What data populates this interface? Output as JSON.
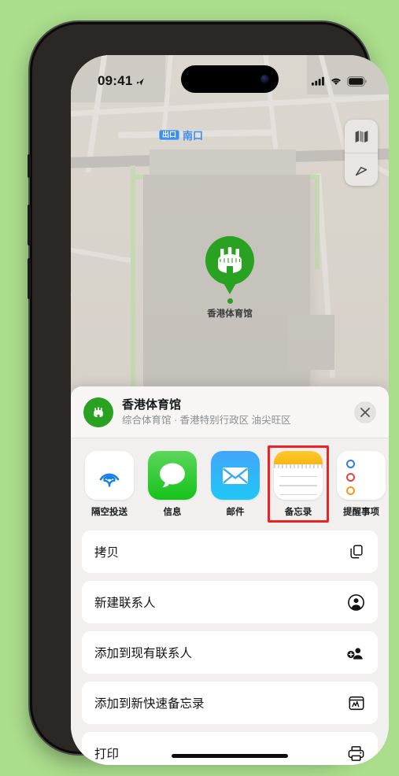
{
  "status_bar": {
    "time": "09:41",
    "location_arrow_icon": "location-arrow-icon",
    "cellular_icon": "cellular-signal-icon",
    "wifi_icon": "wifi-icon",
    "battery_icon": "battery-icon"
  },
  "map": {
    "exit_badge": "出口",
    "exit_label": "南口",
    "poi_label": "香港体育馆",
    "poi_pin_icon": "stadium-pin-icon",
    "controls": [
      {
        "name": "map-type-button",
        "icon": "folded-map-icon"
      },
      {
        "name": "locate-me-button",
        "icon": "navigation-arrow-icon"
      }
    ]
  },
  "share_sheet": {
    "avatar_icon": "stadium-icon",
    "title": "香港体育馆",
    "subtitle": "综合体育馆 · 香港特别行政区 油尖旺区",
    "close_icon": "close-icon",
    "apps": [
      {
        "label": "隔空投送",
        "icon": "airdrop-icon",
        "highlighted": false
      },
      {
        "label": "信息",
        "icon": "messages-icon",
        "highlighted": false
      },
      {
        "label": "邮件",
        "icon": "mail-icon",
        "highlighted": false
      },
      {
        "label": "备忘录",
        "icon": "notes-icon",
        "highlighted": true
      },
      {
        "label": "提醒事项",
        "icon": "reminders-icon",
        "highlighted": false
      }
    ],
    "actions": [
      {
        "label": "拷贝",
        "icon": "copy-icon"
      },
      {
        "label": "新建联系人",
        "icon": "person-circle-icon"
      },
      {
        "label": "添加到现有联系人",
        "icon": "person-add-icon"
      },
      {
        "label": "添加到新快速备忘录",
        "icon": "quick-note-icon"
      },
      {
        "label": "打印",
        "icon": "printer-icon"
      }
    ]
  },
  "colors": {
    "page_background": "#aadd8c",
    "highlight_red": "#ee2222",
    "pin_green": "#2aa221",
    "accent_blue": "#3a8ff0"
  }
}
